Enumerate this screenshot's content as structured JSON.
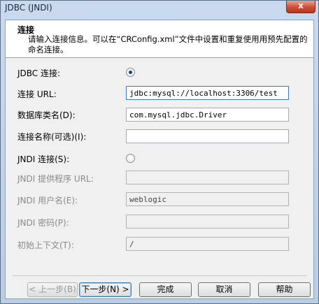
{
  "window": {
    "title": "JDBC (JNDI)",
    "close_glyph": "x"
  },
  "header": {
    "title": "连接",
    "description": "请输入连接信息。可以在“CRConfig.xml”文件中设置和重复使用用预先配置的命名连接。"
  },
  "form": {
    "jdbc_radio_label": "JDBC 连接:",
    "jdbc_selected": true,
    "url_label": "连接 URL:",
    "url_value": "jdbc:mysql://localhost:3306/test",
    "driver_label": "数据库类名(D):",
    "driver_value": "com.mysql.jdbc.Driver",
    "conn_name_label": "连接名称(可选)(I):",
    "conn_name_value": "",
    "jndi_radio_label": "JNDI 连接(S):",
    "jndi_selected": false,
    "jndi_url_label": "JNDI 提供程序 URL:",
    "jndi_url_value": "",
    "jndi_user_label": "JNDI 用户名(E):",
    "jndi_user_value": "weblogic",
    "jndi_pwd_label": "JNDI 密码(P):",
    "jndi_pwd_value": "",
    "initial_ctx_label": "初始上下文(T):",
    "initial_ctx_value": "/"
  },
  "buttons": {
    "back": "< 上一步(B)",
    "next": "下一步(N) >",
    "finish": "完成",
    "cancel": "取消",
    "help": "帮助"
  }
}
